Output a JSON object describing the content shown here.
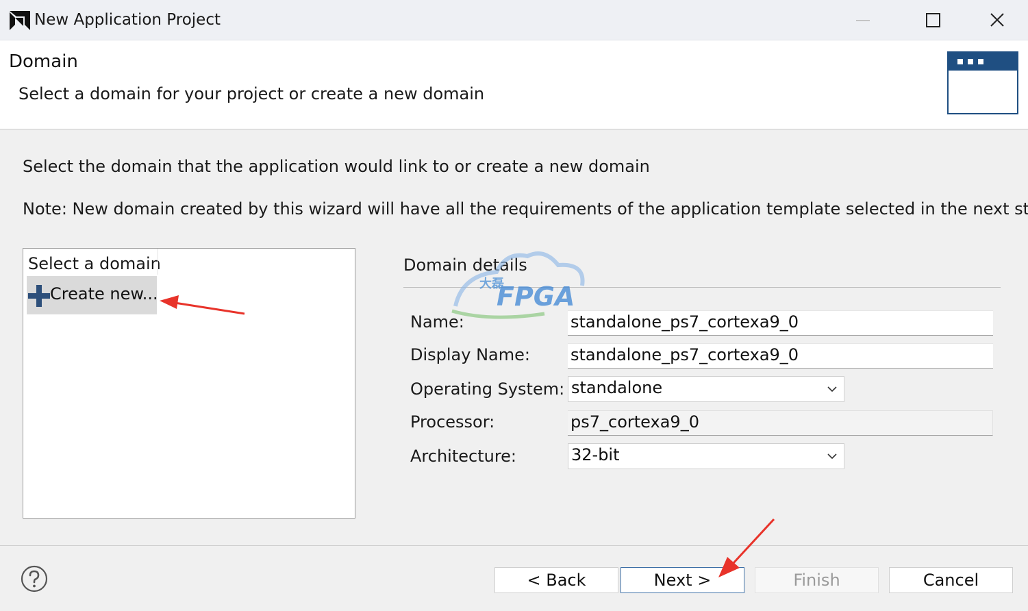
{
  "window": {
    "title": "New Application Project",
    "controls": [
      "minimize-icon",
      "maximize-icon",
      "close-icon"
    ]
  },
  "header": {
    "title": "Domain",
    "subtitle": "Select a domain for your project or create a new domain",
    "banner_icon": "window-icon"
  },
  "body": {
    "intro": "Select the domain that the application would link to or create a new domain",
    "note": "Note: New domain created by this wizard will have all the requirements of the application template selected in the next step"
  },
  "domain_list": {
    "header": "Select a domain",
    "items": [
      {
        "label": "Create new...",
        "icon": "plus-icon",
        "selected": true
      }
    ]
  },
  "details": {
    "title": "Domain details",
    "name_label": "Name:",
    "name_value": "standalone_ps7_cortexa9_0",
    "display_name_label": "Display Name:",
    "display_name_value": "standalone_ps7_cortexa9_0",
    "os_label": "Operating System:",
    "os_value": "standalone",
    "processor_label": "Processor:",
    "processor_value": "ps7_cortexa9_0",
    "arch_label": "Architecture:",
    "arch_value": "32-bit"
  },
  "watermark": {
    "text": "FPGA",
    "glyphs": "大磊"
  },
  "footer": {
    "help_icon": "help-icon",
    "back_label": "< Back",
    "next_label": "Next >",
    "finish_label": "Finish",
    "cancel_label": "Cancel"
  },
  "colors": {
    "annotation_arrow": "#e8332a",
    "banner_blue": "#1f4f82",
    "plus_icon": "#2d4f7a",
    "default_button_border": "#3d6fa6"
  }
}
